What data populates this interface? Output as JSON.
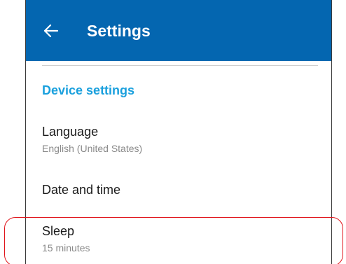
{
  "appbar": {
    "back_icon": "arrow-left-icon",
    "title": "Settings",
    "color": "#0466b0"
  },
  "section": {
    "title": "Device settings",
    "color": "#1aa0dd"
  },
  "items": [
    {
      "title": "Language",
      "subtitle": "English (United States)"
    },
    {
      "title": "Date and time"
    },
    {
      "title": "Sleep",
      "subtitle": "15 minutes"
    }
  ],
  "annotation": {
    "highlight_color": "#e0141b"
  }
}
